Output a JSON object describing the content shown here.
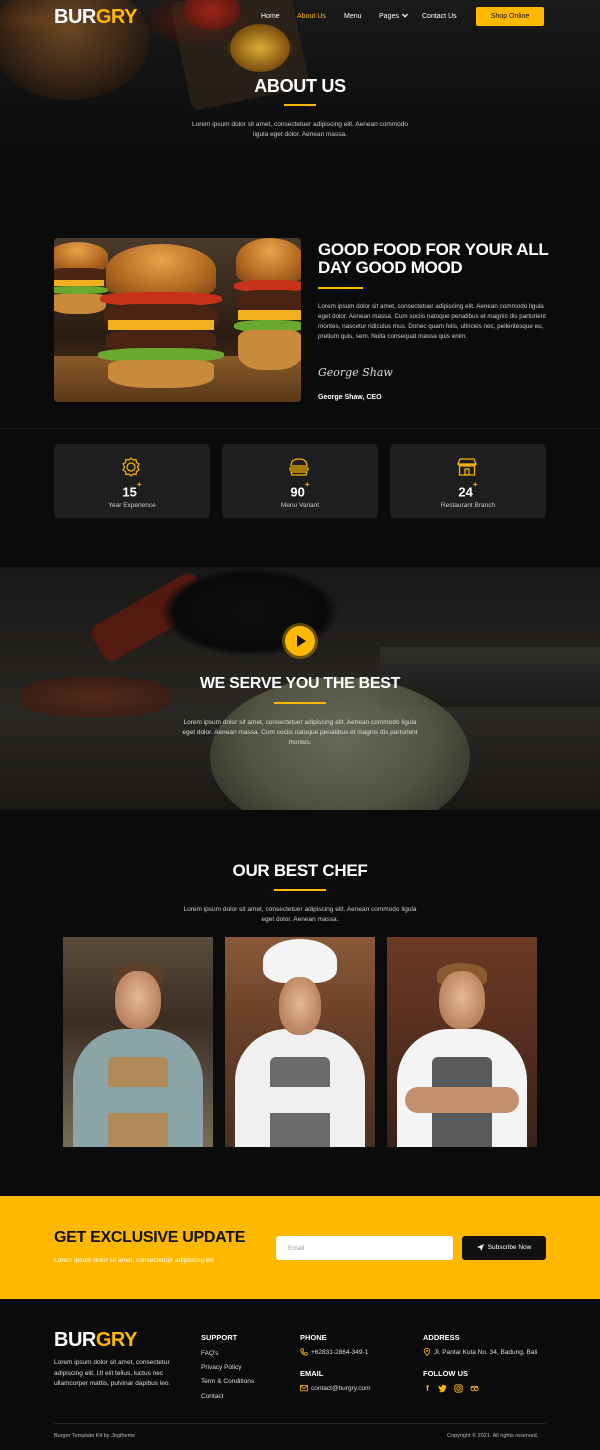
{
  "brand": {
    "part1": "BUR",
    "part2": "GRY",
    "accent": "#ffb800"
  },
  "nav": {
    "items": [
      {
        "label": "Home",
        "active": false
      },
      {
        "label": "About Us",
        "active": true
      },
      {
        "label": "Menu",
        "active": false
      },
      {
        "label": "Pages",
        "active": false,
        "icon": "chevron-down-icon"
      },
      {
        "label": "Contact Us",
        "active": false
      }
    ],
    "shop_label": "Shop Online"
  },
  "hero": {
    "title": "ABOUT US",
    "desc": "Lorem ipsum dolor sit amet, consectetuer adipiscing elit. Aenean commodo ligula eget dolor. Aenean massa."
  },
  "about": {
    "title": "GOOD FOOD FOR YOUR ALL DAY GOOD MOOD",
    "desc": "Lorem ipsum dolor sit amet, consectetuer adipiscing elit. Aenean commodo ligula eget dolor. Aenean massa. Cum sociis natoque penatibus et magnis dis parturient montes, nascetur ridiculus mus. Donec quam felis, ultricies nec, pellentesque eu, pretium quis, sem. Nulla consequat massa quis enim.",
    "signature": "George Shaw",
    "ceo": "George Shaw, CEO"
  },
  "stats": [
    {
      "value": "15",
      "suffix": "+",
      "label": "Year Experience",
      "icon": "award-badge-icon"
    },
    {
      "value": "90",
      "suffix": "+",
      "label": "Menu Variant",
      "icon": "burger-icon"
    },
    {
      "value": "24",
      "suffix": "+",
      "label": "Restaurant Branch",
      "icon": "store-icon"
    }
  ],
  "video": {
    "title": "WE SERVE YOU THE BEST",
    "desc": "Lorem ipsum dolor sit amet, consectetuer adipiscing elit. Aenean commodo ligula eget dolor. Aenean massa. Cum sociis natoque penatibus et magnis dis parturient montes."
  },
  "chefs": {
    "title": "OUR BEST CHEF",
    "desc": "Lorem ipsum dolor sit amet, consectetuer adipiscing elit. Aenean commodo ligula eget dolor. Aenean massa."
  },
  "newsletter": {
    "title": "GET EXCLUSIVE UPDATE",
    "subtitle": "Lorem ipsum dolor sit amet, consectetuer adipiscing elit",
    "email_placeholder": "Email",
    "button_label": "Subscribe Now"
  },
  "footer": {
    "desc": "Lorem ipsum dolor sit amet, consectetur adipiscing elit. Ut elit tellus, luctus nec ullamcorper mattis, pulvinar dapibus leo.",
    "support_title": "SUPPORT",
    "support_links": [
      "FAQ's",
      "Privacy Policy",
      "Term & Conditions",
      "Contact"
    ],
    "phone_title": "PHONE",
    "phone": "+62831-2864-349-1",
    "email_title": "EMAIL",
    "email": "contact@burgry.com",
    "address_title": "ADDRESS",
    "address": "Jl. Pantai Kuta No. 34, Badung, Bali",
    "follow_title": "FOLLOW US",
    "social": [
      "facebook-icon",
      "twitter-icon",
      "instagram-icon",
      "tripadvisor-icon"
    ],
    "credit": "Burger Template Kit by Jegtheme",
    "copyright": "Copyright © 2021. All rights reserved."
  }
}
